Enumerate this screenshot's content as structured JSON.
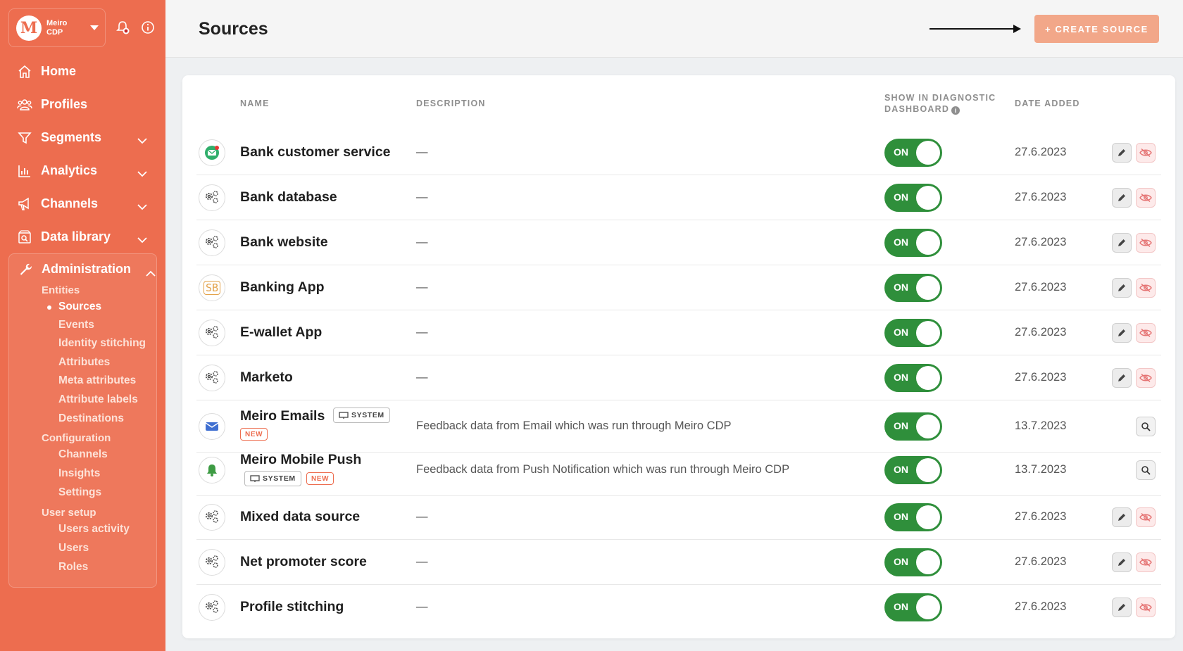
{
  "brand": {
    "name_line1": "Meiro",
    "name_line2": "CDP",
    "logo_letter": "M"
  },
  "sidebar": {
    "items": [
      {
        "label": "Home",
        "icon": "home-icon"
      },
      {
        "label": "Profiles",
        "icon": "users-icon"
      },
      {
        "label": "Segments",
        "icon": "filter-icon"
      },
      {
        "label": "Analytics",
        "icon": "bar-chart-icon"
      },
      {
        "label": "Channels",
        "icon": "megaphone-icon"
      },
      {
        "label": "Data library",
        "icon": "library-search-icon"
      }
    ],
    "admin": {
      "label": "Administration",
      "groups": {
        "entities": "Entities",
        "configuration": "Configuration",
        "user_setup": "User setup"
      },
      "entities": [
        "Sources",
        "Events",
        "Identity stitching",
        "Attributes",
        "Meta attributes",
        "Attribute labels",
        "Destinations"
      ],
      "configuration": [
        "Channels",
        "Insights",
        "Settings"
      ],
      "user_setup": [
        "Users activity",
        "Users",
        "Roles"
      ],
      "active": "Sources"
    }
  },
  "header": {
    "title": "Sources",
    "create_label": "+ CREATE SOURCE"
  },
  "table": {
    "columns": {
      "name": "NAME",
      "description": "DESCRIPTION",
      "diag_line1": "SHOW IN DIAGNOSTIC",
      "diag_line2": "DASHBOARD",
      "date": "DATE ADDED"
    },
    "toggle_label": "ON",
    "system_label": "SYSTEM",
    "new_label": "NEW",
    "rows": [
      {
        "name": "Bank customer service",
        "description": "—",
        "date": "27.6.2023",
        "icon": "email-source-icon"
      },
      {
        "name": "Bank database",
        "description": "—",
        "date": "27.6.2023",
        "icon": "gears-icon"
      },
      {
        "name": "Bank website",
        "description": "—",
        "date": "27.6.2023",
        "icon": "gears-icon"
      },
      {
        "name": "Banking App",
        "description": "—",
        "date": "27.6.2023",
        "icon": "sb-logo-icon",
        "logo_text": "SB"
      },
      {
        "name": "E-wallet App",
        "description": "—",
        "date": "27.6.2023",
        "icon": "gears-icon"
      },
      {
        "name": "Marketo",
        "description": "—",
        "date": "27.6.2023",
        "icon": "gears-icon"
      },
      {
        "name": "Meiro Emails",
        "description": "Feedback data from Email which was run through Meiro CDP",
        "date": "13.7.2023",
        "icon": "envelope-icon"
      },
      {
        "name": "Meiro Mobile Push",
        "description": "Feedback data from Push Notification which was run through Meiro CDP",
        "date": "13.7.2023",
        "icon": "bell-icon"
      },
      {
        "name": "Mixed data source",
        "description": "—",
        "date": "27.6.2023",
        "icon": "gears-icon"
      },
      {
        "name": "Net promoter score",
        "description": "—",
        "date": "27.6.2023",
        "icon": "gears-icon"
      },
      {
        "name": "Profile stitching",
        "description": "—",
        "date": "27.6.2023",
        "icon": "gears-icon"
      }
    ]
  },
  "colors": {
    "brand": "#ed6d4f",
    "toggle_on": "#2f8f3b",
    "create_button": "#f2a789"
  }
}
